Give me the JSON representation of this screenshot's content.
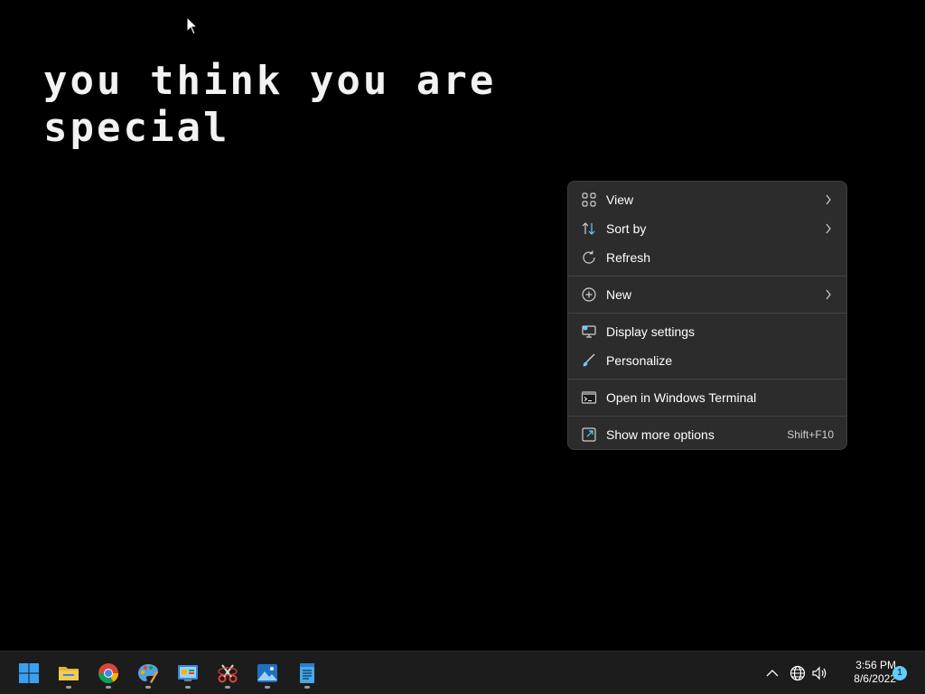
{
  "desktop": {
    "wallpaper_text": "you think you are\nspecial"
  },
  "context_menu": {
    "items": [
      {
        "label": "View",
        "icon": "grid-view-icon",
        "submenu": true
      },
      {
        "label": "Sort by",
        "icon": "sort-icon",
        "submenu": true
      },
      {
        "label": "Refresh",
        "icon": "refresh-icon",
        "submenu": false
      },
      {
        "label": "New",
        "icon": "plus-circle-icon",
        "submenu": true
      },
      {
        "label": "Display settings",
        "icon": "display-icon",
        "submenu": false
      },
      {
        "label": "Personalize",
        "icon": "brush-icon",
        "submenu": false
      },
      {
        "label": "Open in Windows Terminal",
        "icon": "terminal-icon",
        "submenu": false
      },
      {
        "label": "Show more options",
        "icon": "more-options-icon",
        "shortcut": "Shift+F10"
      }
    ]
  },
  "taskbar": {
    "apps": [
      {
        "name": "Start",
        "icon": "windows-start-icon",
        "running": false
      },
      {
        "name": "File Explorer",
        "icon": "folder-icon",
        "running": true
      },
      {
        "name": "Google Chrome",
        "icon": "chrome-icon",
        "running": true
      },
      {
        "name": "Paint",
        "icon": "paint-palette-icon",
        "running": true
      },
      {
        "name": "Control Panel",
        "icon": "control-panel-icon",
        "running": true
      },
      {
        "name": "Snipping Tool",
        "icon": "snipping-tool-icon",
        "running": true
      },
      {
        "name": "Photos",
        "icon": "photos-icon",
        "running": true
      },
      {
        "name": "Notepad",
        "icon": "notepad-icon",
        "running": true
      }
    ],
    "tray": {
      "icons": [
        "chevron-up-icon",
        "globe-icon",
        "speaker-icon"
      ],
      "time": "3:56 PM",
      "date": "8/6/2022",
      "notification_count": "1"
    }
  },
  "colors": {
    "accent": "#60cdff",
    "menu_bg": "#2c2c2c",
    "taskbar_bg": "#1c1c1c"
  }
}
